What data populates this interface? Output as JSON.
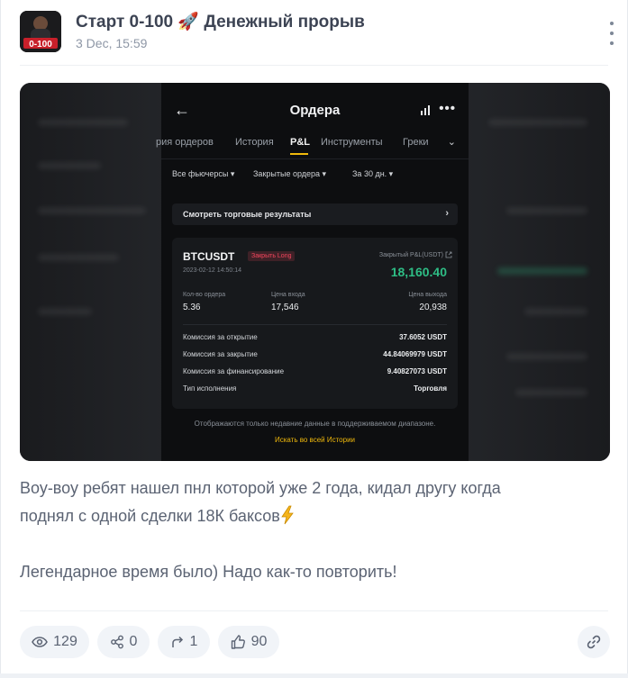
{
  "header": {
    "channel_title": "Старт 0-100 🚀 Денежный прорыв",
    "date": "3 Dec, 15:59",
    "avatar_text": "0-100"
  },
  "screenshot": {
    "title": "Ордера",
    "tabs": [
      "рия ордеров",
      "История",
      "P&L",
      "Инструменты",
      "Греки"
    ],
    "active_tab": "P&L",
    "filters": [
      "Все фьючерсы ▾",
      "Закрытые ордера ▾",
      "За 30 дн. ▾"
    ],
    "results_link": "Смотреть торговые результаты",
    "card": {
      "symbol": "BTCUSDT",
      "badge": "Закрыть Long",
      "datetime": "2023-02-12 14:50:14",
      "pnl_label": "Закрытый P&L(USDT)",
      "pnl_value": "18,160.40",
      "columns": [
        {
          "label": "Кол-во ордера",
          "value": "5.36"
        },
        {
          "label": "Цена входа",
          "value": "17,546"
        },
        {
          "label": "Цена выхода",
          "value": "20,938"
        }
      ],
      "rows": [
        {
          "key": "Комиссия за открытие",
          "value": "37.6052 USDT"
        },
        {
          "key": "Комиссия за закрытие",
          "value": "44.84069979 USDT"
        },
        {
          "key": "Комиссия за финансирование",
          "value": "9.40827073 USDT"
        },
        {
          "key": "Тип исполнения",
          "value": "Торговля"
        }
      ]
    },
    "footnote": "Отображаются только недавние данные в поддерживаемом диапазоне.",
    "search_link": "Искать во всей Истории"
  },
  "post": {
    "line1": "Воу-воу ребят нашел пнл которой уже 2 года, кидал другу когда",
    "line2": "поднял с одной сделки 18К баксов",
    "line3": "Легендарное время было) Надо как-то повторить!"
  },
  "stats": {
    "views": "129",
    "shares": "0",
    "forwards": "1",
    "likes": "90"
  },
  "colors": {
    "pnl_green": "#2ebd85",
    "accent_yellow": "#f0b90b",
    "badge_red": "#f6465d"
  }
}
